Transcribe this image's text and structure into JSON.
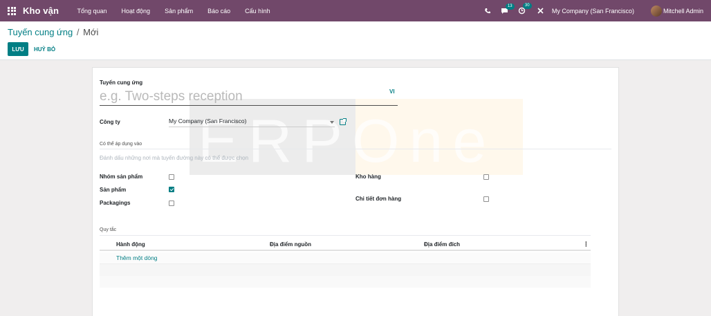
{
  "navbar": {
    "app_name": "Kho vận",
    "menu": [
      "Tổng quan",
      "Hoạt động",
      "Sản phẩm",
      "Báo cáo",
      "Cấu hình"
    ],
    "messages_count": "13",
    "activities_count": "30",
    "company": "My Company (San Francisco)",
    "user": "Mitchell Admin",
    "bg_color": "#71486a"
  },
  "breadcrumb": {
    "parent": "Tuyến cung ứng",
    "separator": "/",
    "current": "Mới"
  },
  "buttons": {
    "save": "LƯU",
    "discard": "HUỶ BỎ"
  },
  "watermark": "ERPOne",
  "form": {
    "route_label": "Tuyến cung ứng",
    "route_placeholder": "e.g. Two-steps reception",
    "lang": "VI",
    "company_label": "Công ty",
    "company_value": "My Company (San Francisco)",
    "applicable_title": "Có thể áp dụng vào",
    "applicable_hint": "Đánh dấu những nơi mà tuyến đường này có thể được chọn",
    "left_checks": [
      {
        "label": "Nhóm sản phẩm",
        "checked": false
      },
      {
        "label": "Sản phẩm",
        "checked": true
      },
      {
        "label": "Packagings",
        "checked": false
      }
    ],
    "right_checks": [
      {
        "label": "Kho hàng",
        "checked": false
      },
      {
        "label": "Chi tiết đơn hàng",
        "checked": false
      }
    ],
    "rules_title": "Quy tắc",
    "rules_columns": [
      "Hành động",
      "Địa điểm nguồn",
      "Địa điểm đích"
    ],
    "add_line": "Thêm một dòng"
  },
  "accent_color": "#017e84"
}
